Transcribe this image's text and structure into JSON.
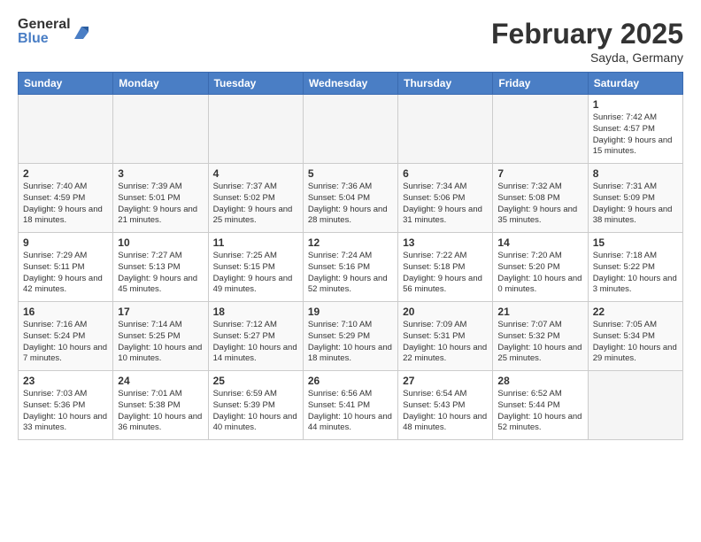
{
  "logo": {
    "general": "General",
    "blue": "Blue"
  },
  "title": "February 2025",
  "subtitle": "Sayda, Germany",
  "weekdays": [
    "Sunday",
    "Monday",
    "Tuesday",
    "Wednesday",
    "Thursday",
    "Friday",
    "Saturday"
  ],
  "weeks": [
    [
      {
        "day": "",
        "info": ""
      },
      {
        "day": "",
        "info": ""
      },
      {
        "day": "",
        "info": ""
      },
      {
        "day": "",
        "info": ""
      },
      {
        "day": "",
        "info": ""
      },
      {
        "day": "",
        "info": ""
      },
      {
        "day": "1",
        "info": "Sunrise: 7:42 AM\nSunset: 4:57 PM\nDaylight: 9 hours and 15 minutes."
      }
    ],
    [
      {
        "day": "2",
        "info": "Sunrise: 7:40 AM\nSunset: 4:59 PM\nDaylight: 9 hours and 18 minutes."
      },
      {
        "day": "3",
        "info": "Sunrise: 7:39 AM\nSunset: 5:01 PM\nDaylight: 9 hours and 21 minutes."
      },
      {
        "day": "4",
        "info": "Sunrise: 7:37 AM\nSunset: 5:02 PM\nDaylight: 9 hours and 25 minutes."
      },
      {
        "day": "5",
        "info": "Sunrise: 7:36 AM\nSunset: 5:04 PM\nDaylight: 9 hours and 28 minutes."
      },
      {
        "day": "6",
        "info": "Sunrise: 7:34 AM\nSunset: 5:06 PM\nDaylight: 9 hours and 31 minutes."
      },
      {
        "day": "7",
        "info": "Sunrise: 7:32 AM\nSunset: 5:08 PM\nDaylight: 9 hours and 35 minutes."
      },
      {
        "day": "8",
        "info": "Sunrise: 7:31 AM\nSunset: 5:09 PM\nDaylight: 9 hours and 38 minutes."
      }
    ],
    [
      {
        "day": "9",
        "info": "Sunrise: 7:29 AM\nSunset: 5:11 PM\nDaylight: 9 hours and 42 minutes."
      },
      {
        "day": "10",
        "info": "Sunrise: 7:27 AM\nSunset: 5:13 PM\nDaylight: 9 hours and 45 minutes."
      },
      {
        "day": "11",
        "info": "Sunrise: 7:25 AM\nSunset: 5:15 PM\nDaylight: 9 hours and 49 minutes."
      },
      {
        "day": "12",
        "info": "Sunrise: 7:24 AM\nSunset: 5:16 PM\nDaylight: 9 hours and 52 minutes."
      },
      {
        "day": "13",
        "info": "Sunrise: 7:22 AM\nSunset: 5:18 PM\nDaylight: 9 hours and 56 minutes."
      },
      {
        "day": "14",
        "info": "Sunrise: 7:20 AM\nSunset: 5:20 PM\nDaylight: 10 hours and 0 minutes."
      },
      {
        "day": "15",
        "info": "Sunrise: 7:18 AM\nSunset: 5:22 PM\nDaylight: 10 hours and 3 minutes."
      }
    ],
    [
      {
        "day": "16",
        "info": "Sunrise: 7:16 AM\nSunset: 5:24 PM\nDaylight: 10 hours and 7 minutes."
      },
      {
        "day": "17",
        "info": "Sunrise: 7:14 AM\nSunset: 5:25 PM\nDaylight: 10 hours and 10 minutes."
      },
      {
        "day": "18",
        "info": "Sunrise: 7:12 AM\nSunset: 5:27 PM\nDaylight: 10 hours and 14 minutes."
      },
      {
        "day": "19",
        "info": "Sunrise: 7:10 AM\nSunset: 5:29 PM\nDaylight: 10 hours and 18 minutes."
      },
      {
        "day": "20",
        "info": "Sunrise: 7:09 AM\nSunset: 5:31 PM\nDaylight: 10 hours and 22 minutes."
      },
      {
        "day": "21",
        "info": "Sunrise: 7:07 AM\nSunset: 5:32 PM\nDaylight: 10 hours and 25 minutes."
      },
      {
        "day": "22",
        "info": "Sunrise: 7:05 AM\nSunset: 5:34 PM\nDaylight: 10 hours and 29 minutes."
      }
    ],
    [
      {
        "day": "23",
        "info": "Sunrise: 7:03 AM\nSunset: 5:36 PM\nDaylight: 10 hours and 33 minutes."
      },
      {
        "day": "24",
        "info": "Sunrise: 7:01 AM\nSunset: 5:38 PM\nDaylight: 10 hours and 36 minutes."
      },
      {
        "day": "25",
        "info": "Sunrise: 6:59 AM\nSunset: 5:39 PM\nDaylight: 10 hours and 40 minutes."
      },
      {
        "day": "26",
        "info": "Sunrise: 6:56 AM\nSunset: 5:41 PM\nDaylight: 10 hours and 44 minutes."
      },
      {
        "day": "27",
        "info": "Sunrise: 6:54 AM\nSunset: 5:43 PM\nDaylight: 10 hours and 48 minutes."
      },
      {
        "day": "28",
        "info": "Sunrise: 6:52 AM\nSunset: 5:44 PM\nDaylight: 10 hours and 52 minutes."
      },
      {
        "day": "",
        "info": ""
      }
    ]
  ]
}
